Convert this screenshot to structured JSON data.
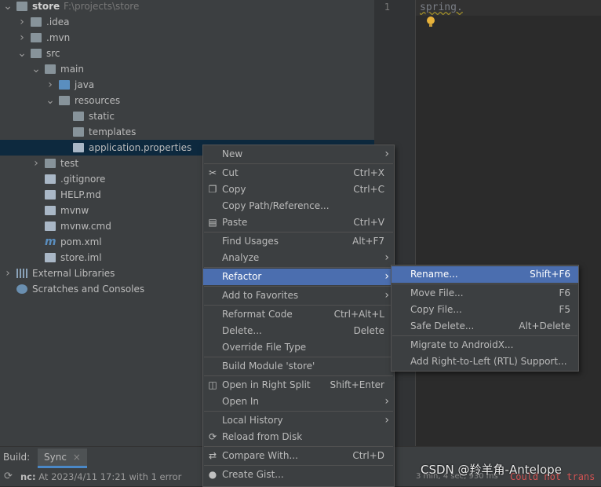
{
  "project_tree": [
    {
      "label": "store",
      "hint": "F:\\projects\\store",
      "level": 0,
      "arrow": "▾",
      "icon": "folder",
      "bold": true
    },
    {
      "label": ".idea",
      "level": 1,
      "arrow": "›",
      "icon": "folder"
    },
    {
      "label": ".mvn",
      "level": 1,
      "arrow": "›",
      "icon": "folder"
    },
    {
      "label": "src",
      "level": 1,
      "arrow": "▾",
      "icon": "folder"
    },
    {
      "label": "main",
      "level": 2,
      "arrow": "▾",
      "icon": "folder"
    },
    {
      "label": "java",
      "level": 3,
      "arrow": "›",
      "icon": "folder-blue"
    },
    {
      "label": "resources",
      "level": 3,
      "arrow": "▾",
      "icon": "folder-res"
    },
    {
      "label": "static",
      "level": 4,
      "arrow": "",
      "icon": "folder"
    },
    {
      "label": "templates",
      "level": 4,
      "arrow": "",
      "icon": "folder"
    },
    {
      "label": "application.properties",
      "level": 4,
      "arrow": "",
      "icon": "properties-file",
      "selected": true
    },
    {
      "label": "test",
      "level": 2,
      "arrow": "›",
      "icon": "folder"
    },
    {
      "label": ".gitignore",
      "level": 2,
      "arrow": "",
      "icon": "gitignore-file"
    },
    {
      "label": "HELP.md",
      "level": 2,
      "arrow": "",
      "icon": "markdown-file"
    },
    {
      "label": "mvnw",
      "level": 2,
      "arrow": "",
      "icon": "shell-file"
    },
    {
      "label": "mvnw.cmd",
      "level": 2,
      "arrow": "",
      "icon": "cmd-file"
    },
    {
      "label": "pom.xml",
      "level": 2,
      "arrow": "",
      "icon": "maven-file"
    },
    {
      "label": "store.iml",
      "level": 2,
      "arrow": "",
      "icon": "iml-file"
    },
    {
      "label": "External Libraries",
      "level": 0,
      "arrow": "›",
      "icon": "libraries"
    },
    {
      "label": "Scratches and Consoles",
      "level": 0,
      "arrow": "",
      "icon": "scratches"
    }
  ],
  "editor": {
    "line_number": "1",
    "code": "spring."
  },
  "context_menu": [
    {
      "label": "New",
      "shortcut": "",
      "submenu": true,
      "icon": ""
    },
    {
      "sep": true
    },
    {
      "label": "Cut",
      "shortcut": "Ctrl+X",
      "icon": "✂"
    },
    {
      "label": "Copy",
      "shortcut": "Ctrl+C",
      "icon": "❐"
    },
    {
      "label": "Copy Path/Reference...",
      "shortcut": "",
      "icon": ""
    },
    {
      "label": "Paste",
      "shortcut": "Ctrl+V",
      "icon": "▤"
    },
    {
      "sep": true
    },
    {
      "label": "Find Usages",
      "shortcut": "Alt+F7",
      "icon": ""
    },
    {
      "label": "Analyze",
      "shortcut": "",
      "submenu": true,
      "icon": ""
    },
    {
      "sep": true
    },
    {
      "label": "Refactor",
      "shortcut": "",
      "submenu": true,
      "active": true,
      "icon": ""
    },
    {
      "sep": true
    },
    {
      "label": "Add to Favorites",
      "shortcut": "",
      "submenu": true,
      "icon": ""
    },
    {
      "sep": true
    },
    {
      "label": "Reformat Code",
      "shortcut": "Ctrl+Alt+L",
      "icon": ""
    },
    {
      "label": "Delete...",
      "shortcut": "Delete",
      "icon": ""
    },
    {
      "label": "Override File Type",
      "shortcut": "",
      "icon": ""
    },
    {
      "sep": true
    },
    {
      "label": "Build Module 'store'",
      "shortcut": "",
      "icon": ""
    },
    {
      "sep": true
    },
    {
      "label": "Open in Right Split",
      "shortcut": "Shift+Enter",
      "icon": "◫"
    },
    {
      "label": "Open In",
      "shortcut": "",
      "submenu": true,
      "icon": ""
    },
    {
      "sep": true
    },
    {
      "label": "Local History",
      "shortcut": "",
      "submenu": true,
      "icon": ""
    },
    {
      "label": "Reload from Disk",
      "shortcut": "",
      "icon": "⟳"
    },
    {
      "sep": true
    },
    {
      "label": "Compare With...",
      "shortcut": "Ctrl+D",
      "icon": "⇄"
    },
    {
      "sep": true
    },
    {
      "label": "Create Gist...",
      "shortcut": "",
      "icon": "●"
    }
  ],
  "refactor_submenu": [
    {
      "label": "Rename...",
      "shortcut": "Shift+F6",
      "active": true
    },
    {
      "sep": true
    },
    {
      "label": "Move File...",
      "shortcut": "F6"
    },
    {
      "label": "Copy File...",
      "shortcut": "F5"
    },
    {
      "label": "Safe Delete...",
      "shortcut": "Alt+Delete"
    },
    {
      "sep": true
    },
    {
      "label": "Migrate to AndroidX...",
      "shortcut": ""
    },
    {
      "label": "Add Right-to-Left (RTL) Support...",
      "shortcut": ""
    }
  ],
  "build": {
    "label": "Build:",
    "tab": "Sync",
    "tab_close": "×",
    "status_prefix": "nc:",
    "status": "At 2023/4/11 17:21 with 1 error",
    "right_status": "3 min, 4 sec, 930 ms",
    "error_snippet": "Could not trans"
  },
  "watermark": "CSDN @羚羊角-Antelope",
  "colors": {
    "selection": "#0d293e",
    "menu_active": "#4b6eaf",
    "panel": "#3c3f41",
    "editor": "#2b2b2b"
  }
}
